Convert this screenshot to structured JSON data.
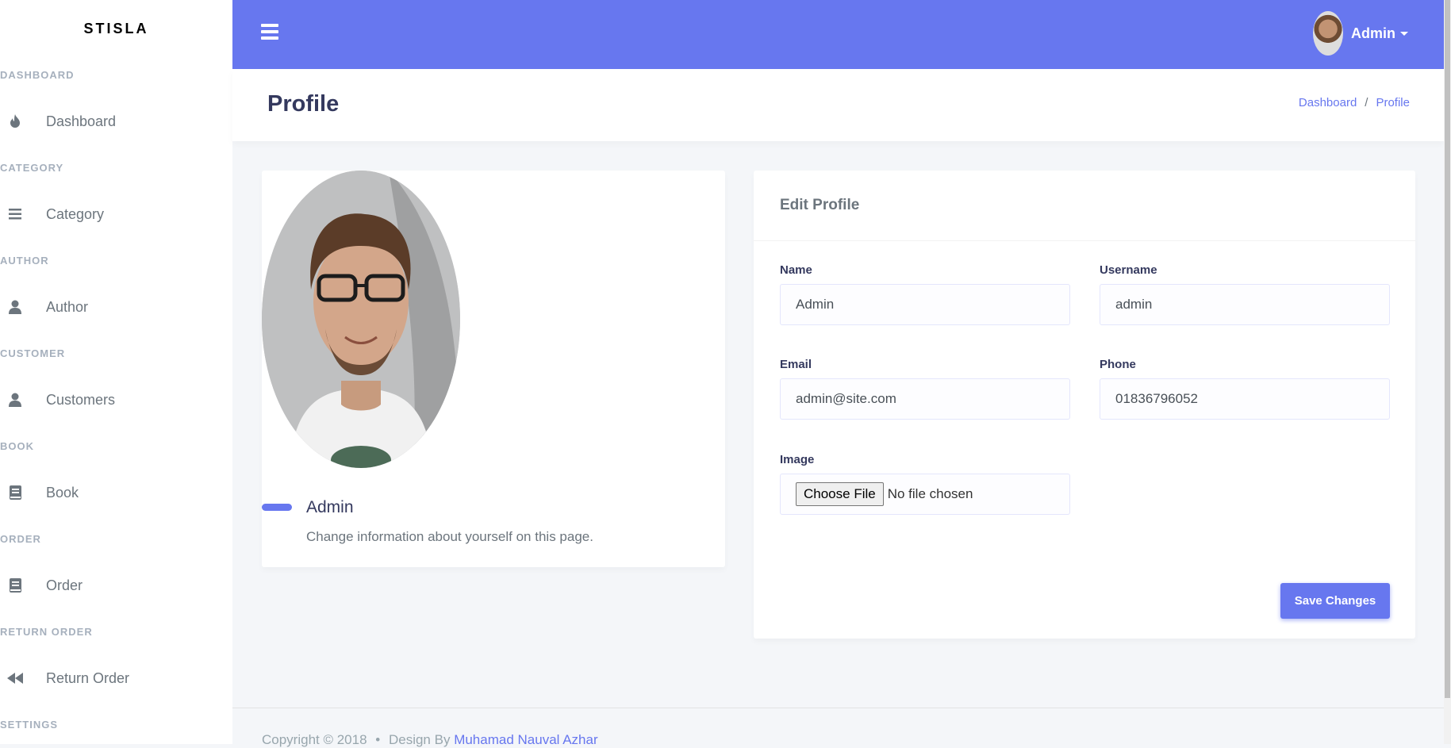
{
  "brand": "STISLA",
  "sidebar": {
    "sections": [
      {
        "header": "DASHBOARD",
        "label": "Dashboard",
        "icon": "fire-icon"
      },
      {
        "header": "CATEGORY",
        "label": "Category",
        "icon": "list-icon"
      },
      {
        "header": "AUTHOR",
        "label": "Author",
        "icon": "user-icon"
      },
      {
        "header": "CUSTOMER",
        "label": "Customers",
        "icon": "user-icon"
      },
      {
        "header": "BOOK",
        "label": "Book",
        "icon": "book-icon"
      },
      {
        "header": "ORDER",
        "label": "Order",
        "icon": "book-icon"
      },
      {
        "header": "RETURN ORDER",
        "label": "Return Order",
        "icon": "backward-icon"
      },
      {
        "header": "SETTINGS"
      }
    ]
  },
  "navbar": {
    "user_name": "Admin",
    "accent": "#6777ef"
  },
  "header": {
    "title": "Profile",
    "breadcrumb": [
      "Dashboard",
      "Profile"
    ],
    "breadcrumb_sep": "/"
  },
  "profile": {
    "name": "Admin",
    "description": "Change information about yourself on this page."
  },
  "edit_profile": {
    "title": "Edit Profile",
    "name_label": "Name",
    "name_value": "Admin",
    "username_label": "Username",
    "username_value": "admin",
    "email_label": "Email",
    "email_value": "admin@site.com",
    "phone_label": "Phone",
    "phone_value": "01836796052",
    "image_label": "Image",
    "file_button": "Choose File",
    "file_status": "No file chosen",
    "save_label": "Save Changes"
  },
  "footer": {
    "copyright": "Copyright © 2018",
    "dot": "•",
    "design_by": "Design By",
    "author": "Muhamad Nauval Azhar"
  }
}
